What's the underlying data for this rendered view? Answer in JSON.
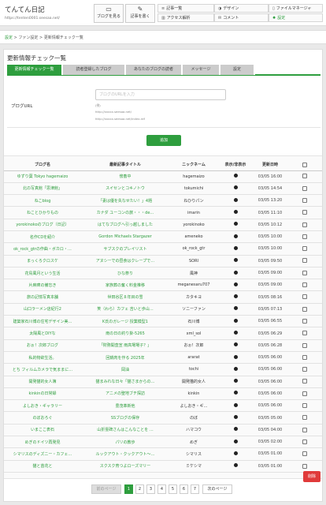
{
  "site": {
    "title": "てんてん日記",
    "url": "https://tenten0001.seesaa.net/"
  },
  "header_buttons": [
    {
      "label": "ブログを見る",
      "icon": "monitor-icon"
    },
    {
      "label": "記事を書く",
      "icon": "pencil-icon"
    }
  ],
  "menu": [
    {
      "label": "記事一覧",
      "icon": "list-icon",
      "active": false
    },
    {
      "label": "デザイン",
      "icon": "palette-icon",
      "active": false
    },
    {
      "label": "ファイルマネージャ",
      "icon": "file-icon",
      "active": false
    },
    {
      "label": "アクセス解析",
      "icon": "chart-icon",
      "active": false
    },
    {
      "label": "コメント",
      "icon": "comment-icon",
      "active": false
    },
    {
      "label": "設定",
      "icon": "gear-icon",
      "active": true
    }
  ],
  "breadcrumb": {
    "item1": "設定",
    "sep": ">",
    "item2": "ファン設定",
    "item3": "更新情報チェック一覧"
  },
  "page_title": "更新情報チェック一覧",
  "tabs": [
    {
      "label": "更新情報チェック一覧",
      "active": true
    },
    {
      "label": "読者登録したブログ",
      "active": false
    },
    {
      "label": "あなたのブログの読者",
      "active": false
    },
    {
      "label": "メッセージ",
      "active": false
    },
    {
      "label": "設定",
      "active": false
    }
  ],
  "form": {
    "label": "ブログURL",
    "placeholder": "ブログのURLを入力",
    "example_heading": "(例)",
    "example1": "http://xxxxx.seesaa.net/",
    "example2": "http://xxxxx.seesaa.net/index.rdf",
    "add_button": "追加"
  },
  "table": {
    "headers": {
      "blog": "ブログ名",
      "title": "最新記事タイトル",
      "nick": "ニックネーム",
      "show": "表示/非表示",
      "date": "更新日時"
    },
    "rows": [
      {
        "blog": "ゆずり葉 Tokyo hagemaizo",
        "title": "傍畜中",
        "nick": "hagemaizo",
        "date": "03/05 16:00"
      },
      {
        "blog": "北の写真館「思津館」",
        "title": "スイセンとコキノトウ",
        "nick": "tokumichi",
        "date": "03/05 14:54"
      },
      {
        "blog": "ねこblog",
        "title": "「妻は優を失なせたい！」4題",
        "nick": "ねひりパン",
        "date": "03/05 13:20"
      },
      {
        "blog": "ねことひかりもの",
        "title": "カナダ ユーコンの旅・・・de…",
        "nick": "imarin",
        "date": "03/05 11:10"
      },
      {
        "blog": "yorokinokoのブログ（日記）",
        "title": "はてなブログへ引っ越しました",
        "nick": "yorokinoko",
        "date": "03/05 10:12"
      },
      {
        "blog": "名作CDを紹介",
        "title": "Gordon Michaels Stargazer",
        "nick": "ameneko",
        "date": "03/05 10:00"
      },
      {
        "blog": "ok_rock_gtrの作曲・ボカロ・…",
        "title": "サブスクのプレイリスト",
        "nick": "ok_rock_gtr",
        "date": "03/05 10:00"
      },
      {
        "blog": "まっくろクロスケ",
        "title": "アヌシーでの昼食はクレープで…",
        "nick": "SORI",
        "date": "03/05 09:50"
      },
      {
        "blog": "花鳥風月という生活",
        "title": "ひな祭り",
        "nick": "風神",
        "date": "03/05 09:00"
      },
      {
        "blog": "片麻痺の備忘き",
        "title": "家族葬の奮く料金推移",
        "nick": "meganesaru707",
        "date": "03/05 09:00"
      },
      {
        "blog": "旅の記憶写真本舗",
        "title": "世田谷区８年目の雪",
        "nick": "カタキヨ",
        "date": "03/05 08:16"
      },
      {
        "blog": "山口ラーメン店紀行2",
        "title": "笑（わら）カフェ 吉いと歩山…",
        "nick": "ソニーファン",
        "date": "03/05 07:13"
      },
      {
        "blog": "建築家石川博の住宅デザイン美…",
        "title": "K氏のガレージ 授業模型1",
        "nick": "石川博",
        "date": "03/05 06:55"
      },
      {
        "blog": "太陽風とDIYな",
        "title": "雨の日の釣り掛-5265",
        "nick": "xml_sol",
        "date": "03/05 06:29"
      },
      {
        "blog": "おぉ！次郎ブログ",
        "title": "「財務開査宣 雨高場場子？」",
        "nick": "おぉ！次郎",
        "date": "03/05 06:28"
      },
      {
        "blog": "私的物欲生活。",
        "title": "回鍋肉を作る 2025年",
        "nick": "ararat",
        "date": "03/05 06:00"
      },
      {
        "blog": "とち フィルムカメラで気ままに…",
        "title": "岡油",
        "nick": "tochi",
        "date": "03/05 06:00"
      },
      {
        "blog": "開発猫的女人簿",
        "title": "猫まみれな日々「猫さまからの…",
        "nick": "開発猫的女人",
        "date": "03/05 06:00"
      },
      {
        "blog": "kinkinの日常録",
        "title": "アニメの聖地ブチ探訪",
        "nick": "kinkin",
        "date": "03/05 06:00"
      },
      {
        "blog": "よしおき・ギャラリー",
        "title": "豊茂革新他",
        "nick": "よしおき・ギ…",
        "date": "03/05 06:00"
      },
      {
        "blog": "のぼおろぐ",
        "title": "SSブログの保存",
        "nick": "のぼ",
        "date": "03/05 05:00"
      },
      {
        "blog": "いまここ表石",
        "title": "山折霊碑さんはこんなことを …",
        "nick": "ハマコウ",
        "date": "03/05 04:00"
      },
      {
        "blog": "めぎのドイツ再発見",
        "title": "パリの教歩",
        "nick": "めぎ",
        "date": "03/05 02:00"
      },
      {
        "blog": "シマリスのディズニー・カフェ…",
        "title": "ルックアウト・クックアウト〜…",
        "nick": "シマリス",
        "date": "03/05 01:00"
      },
      {
        "blog": "猫と苗花と",
        "title": "スクスク育つよローズマリー",
        "nick": "ミケシマ",
        "date": "03/05 01:00"
      }
    ]
  },
  "delete_button": "削除",
  "pagination": {
    "prev": "前のページ",
    "pages": [
      "1",
      "2",
      "3",
      "4",
      "5",
      "6",
      "7"
    ],
    "current": "1",
    "next": "次のページ"
  },
  "colors": {
    "accent": "#2e9e3e",
    "danger": "#e03a3a"
  }
}
